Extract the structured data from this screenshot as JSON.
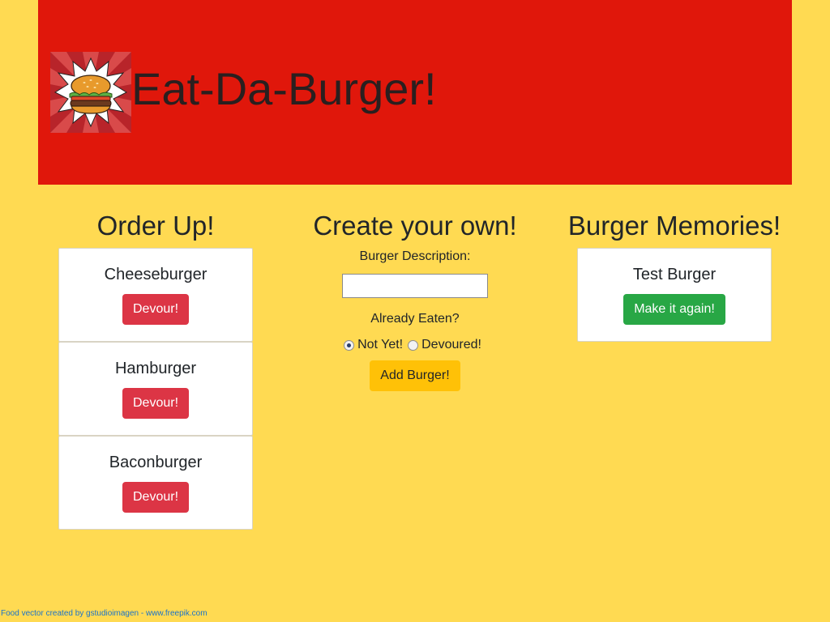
{
  "header": {
    "title": "Eat-Da-Burger!",
    "logo_icon": "burger-logo-icon",
    "banner_color": "#e0170b"
  },
  "order_up": {
    "title": "Order Up!",
    "items": [
      {
        "name": "Cheeseburger",
        "button": "Devour!"
      },
      {
        "name": "Hamburger",
        "button": "Devour!"
      },
      {
        "name": "Baconburger",
        "button": "Devour!"
      }
    ]
  },
  "create": {
    "title": "Create your own!",
    "description_label": "Burger Description:",
    "description_value": "",
    "eaten_label": "Already Eaten?",
    "options": [
      {
        "label": "Not Yet!",
        "checked": true
      },
      {
        "label": "Devoured!",
        "checked": false
      }
    ],
    "submit_label": "Add Burger!"
  },
  "memories": {
    "title": "Burger Memories!",
    "items": [
      {
        "name": "Test Burger",
        "button": "Make it again!"
      }
    ]
  },
  "footer": {
    "credit": "Food vector created by gstudioimagen - www.freepik.com"
  },
  "colors": {
    "background": "#ffda52",
    "devour_button": "#dc3545",
    "again_button": "#28a745",
    "add_button": "#ffc107"
  }
}
